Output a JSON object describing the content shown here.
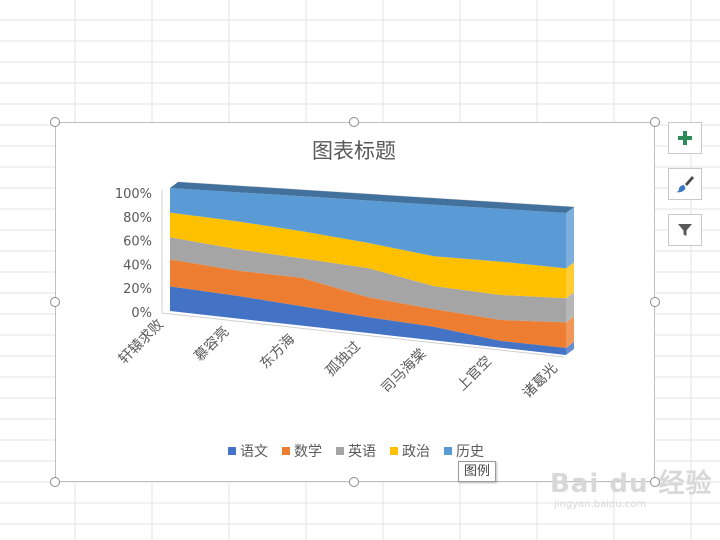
{
  "chart_data": {
    "type": "area",
    "subtype": "3d-100%-stacked",
    "title": "图表标题",
    "categories": [
      "轩辕求败",
      "慕容亮",
      "东方海",
      "孤独过",
      "司马海棠",
      "上官空",
      "诸葛光"
    ],
    "series": [
      {
        "name": "语文",
        "color": "#4472C4",
        "values": [
          20,
          18,
          15,
          12,
          10,
          5,
          5
        ]
      },
      {
        "name": "数学",
        "color": "#ED7D31",
        "values": [
          22,
          20,
          22,
          15,
          13,
          15,
          18
        ]
      },
      {
        "name": "英语",
        "color": "#A5A5A5",
        "values": [
          18,
          17,
          15,
          22,
          17,
          18,
          17
        ]
      },
      {
        "name": "政治",
        "color": "#FFC000",
        "values": [
          20,
          22,
          21,
          19,
          22,
          24,
          21
        ]
      },
      {
        "name": "历史",
        "color": "#5B9BD5",
        "values": [
          20,
          23,
          27,
          32,
          38,
          38,
          39
        ]
      }
    ],
    "y_ticks": [
      "0%",
      "20%",
      "40%",
      "60%",
      "80%",
      "100%"
    ],
    "ylim": [
      0,
      100
    ],
    "legend_position": "bottom",
    "grid": true
  },
  "legend_labels": [
    "语文",
    "数学",
    "英语",
    "政治",
    "历史"
  ],
  "tooltip": "图例",
  "side_buttons": {
    "add_element": "plus-icon",
    "chart_styles": "brush-icon",
    "chart_filters": "filter-icon"
  },
  "watermark": {
    "logo": "Bai du 经验",
    "url": "jingyan.baidu.com"
  }
}
